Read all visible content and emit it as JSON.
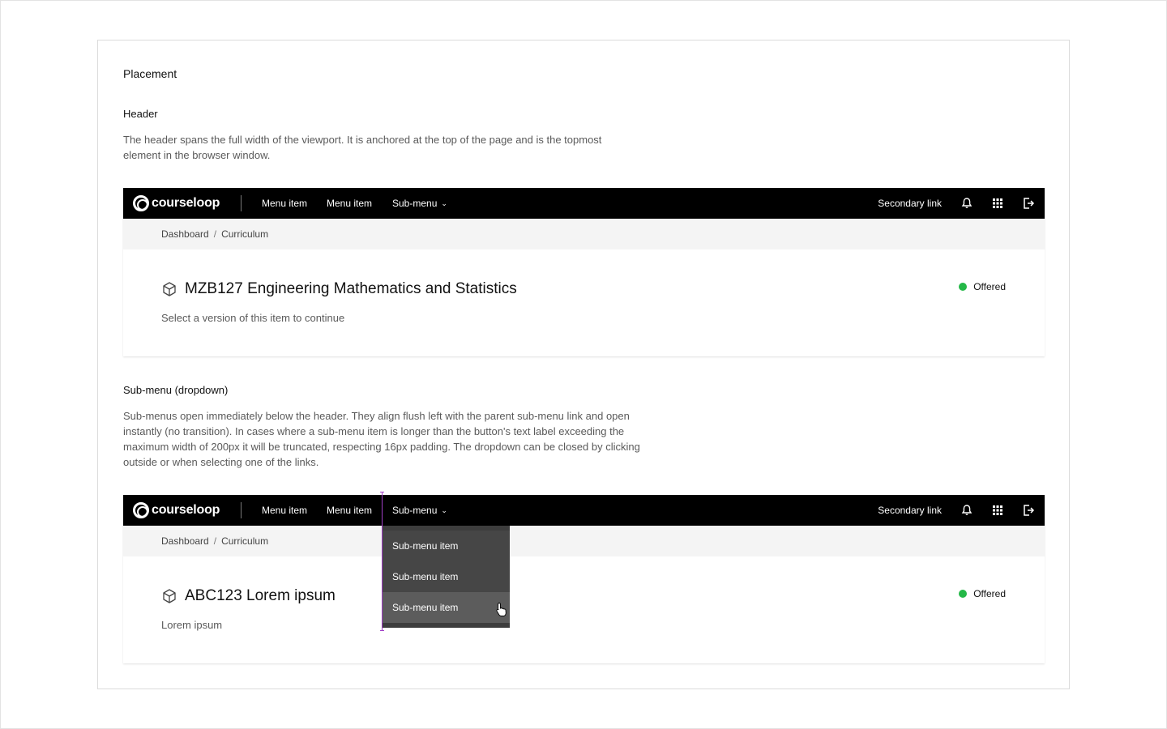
{
  "section": {
    "title": "Placement"
  },
  "header_section": {
    "title": "Header",
    "description": "The header spans the full width of the viewport. It is anchored at the top of the page and is the topmost element in the browser window."
  },
  "submenu_section": {
    "title": "Sub-menu (dropdown)",
    "description": "Sub-menus open immediately below the header. They align flush left with the parent sub-menu link and open instantly (no transition). In cases where a sub-menu item is longer than the button's text label exceeding the maximum width of 200px it will be truncated, respecting 16px padding. The dropdown can be closed by clicking outside or when selecting one of the links."
  },
  "app_header": {
    "logo_text": "courseloop",
    "menu_items": [
      "Menu item",
      "Menu item"
    ],
    "submenu_label": "Sub-menu",
    "secondary_link": "Secondary link",
    "icons": [
      "bell-icon",
      "grid-icon",
      "logout-icon"
    ]
  },
  "breadcrumb": [
    "Dashboard",
    "Curriculum"
  ],
  "example1": {
    "title": "MZB127 Engineering Mathematics and Statistics",
    "subtitle": "Select a version of this item to continue",
    "status": "Offered",
    "status_color": "#24b847"
  },
  "example2": {
    "title": "ABC123 Lorem ipsum",
    "subtitle": "Lorem ipsum",
    "status": "Offered",
    "dropdown_items": [
      "Sub-menu item",
      "Sub-menu item",
      "Sub-menu item"
    ],
    "hovered_index": 2
  },
  "colors": {
    "header_bg": "#000000",
    "breadcrumb_bg": "#f4f4f4",
    "dropdown_bg": "#464646",
    "dropdown_hover": "#5c5c5c",
    "guide": "#a13ec7"
  }
}
